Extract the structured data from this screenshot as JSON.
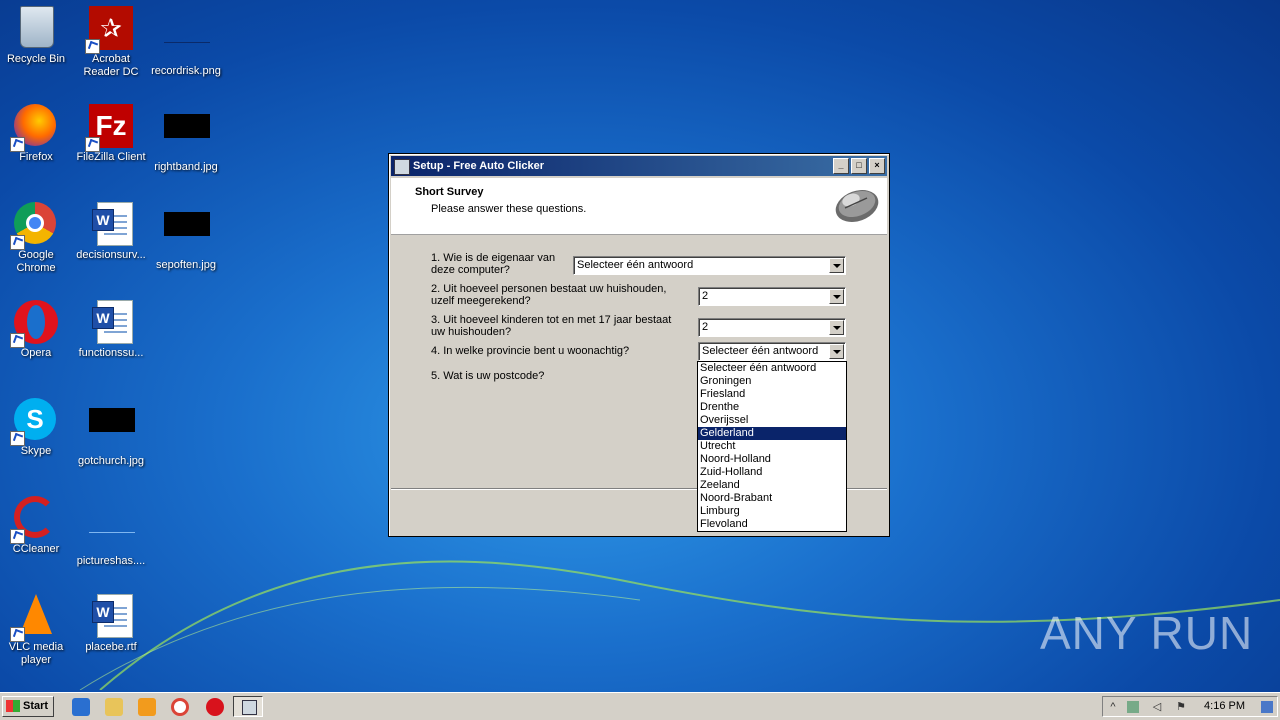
{
  "desktop": {
    "icons": [
      {
        "label": "Recycle Bin",
        "icon": "recycle-bin-icon"
      },
      {
        "label": "Acrobat Reader DC",
        "icon": "acrobat-icon"
      },
      {
        "label": "recordrisk.png",
        "icon": "image-file-icon"
      },
      {
        "label": "Firefox",
        "icon": "firefox-icon"
      },
      {
        "label": "FileZilla Client",
        "icon": "filezilla-icon"
      },
      {
        "label": "rightband.jpg",
        "icon": "image-file-icon"
      },
      {
        "label": "Google Chrome",
        "icon": "chrome-icon"
      },
      {
        "label": "decisionsurv...",
        "icon": "word-doc-icon"
      },
      {
        "label": "sepoften.jpg",
        "icon": "image-file-icon"
      },
      {
        "label": "Opera",
        "icon": "opera-icon"
      },
      {
        "label": "functionssu...",
        "icon": "word-doc-icon"
      },
      {
        "label": "Skype",
        "icon": "skype-icon"
      },
      {
        "label": "gotchurch.jpg",
        "icon": "image-file-icon"
      },
      {
        "label": "CCleaner",
        "icon": "ccleaner-icon"
      },
      {
        "label": "pictureshas....",
        "icon": "image-file-icon"
      },
      {
        "label": "VLC media player",
        "icon": "vlc-icon"
      },
      {
        "label": "placebe.rtf",
        "icon": "word-doc-icon"
      }
    ]
  },
  "window": {
    "title": "Setup - Free Auto Clicker",
    "header_title": "Short Survey",
    "header_sub": "Please answer these questions.",
    "questions": [
      {
        "text": "1. Wie is de eigenaar van deze computer?",
        "value": "Selecteer één antwoord"
      },
      {
        "text": "2. Uit hoeveel personen bestaat uw huishouden, uzelf meegerekend?",
        "value": "2"
      },
      {
        "text": "3. Uit hoeveel kinderen tot en met 17 jaar bestaat uw huishouden?",
        "value": "2"
      },
      {
        "text": "4. In welke provincie bent u woonachtig?",
        "value": "Selecteer één antwoord"
      },
      {
        "text": "5. Wat is uw postcode?"
      }
    ],
    "dropdown_options": [
      "Selecteer één antwoord",
      "Groningen",
      "Friesland",
      "Drenthe",
      "Overijssel",
      "Gelderland",
      "Utrecht",
      "Noord-Holland",
      "Zuid-Holland",
      "Zeeland",
      "Noord-Brabant",
      "Limburg",
      "Flevoland"
    ],
    "dropdown_selected": "Gelderland"
  },
  "taskbar": {
    "start_label": "Start",
    "clock": "4:16 PM"
  },
  "watermark": "ANY RUN"
}
